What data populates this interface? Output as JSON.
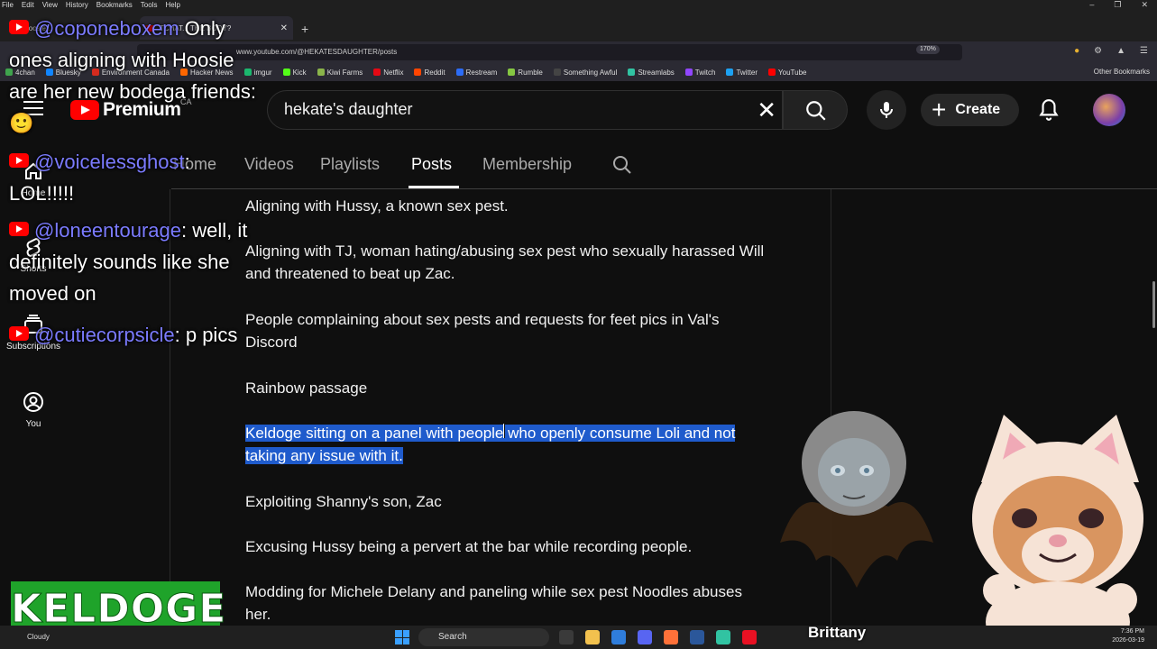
{
  "browser": {
    "menu": [
      "File",
      "Edit",
      "View",
      "History",
      "Bookmarks",
      "Tools",
      "Help"
    ],
    "tabs": [
      {
        "label": "Hoosie...",
        "active": false
      },
      {
        "label": "TCHAT... THE BODY?",
        "active": true
      }
    ],
    "url": "www.youtube.com/@HEKATESDAUGHTER/posts",
    "zoom": "170%",
    "bookmarks": [
      {
        "label": "4chan",
        "color": "#3fa34d"
      },
      {
        "label": "Bluesky",
        "color": "#1185fe"
      },
      {
        "label": "Environment Canada",
        "color": "#d52b1e"
      },
      {
        "label": "Hacker News",
        "color": "#ff6600"
      },
      {
        "label": "imgur",
        "color": "#1bb76e"
      },
      {
        "label": "Kick",
        "color": "#53fc18"
      },
      {
        "label": "Kiwi Farms",
        "color": "#8ab44a"
      },
      {
        "label": "Netflix",
        "color": "#e50914"
      },
      {
        "label": "Reddit",
        "color": "#ff4500"
      },
      {
        "label": "Restream",
        "color": "#2c6cf6"
      },
      {
        "label": "Rumble",
        "color": "#85c742"
      },
      {
        "label": "Something Awful",
        "color": "#444444"
      },
      {
        "label": "Streamlabs",
        "color": "#31c3a2"
      },
      {
        "label": "Twitch",
        "color": "#9146ff"
      },
      {
        "label": "Twitter",
        "color": "#1da1f2"
      },
      {
        "label": "YouTube",
        "color": "#ff0000"
      }
    ],
    "other_bookmarks": "Other Bookmarks"
  },
  "youtube": {
    "logo_text": "Premium",
    "region": "CA",
    "search_value": "hekate's daughter",
    "create_label": "Create",
    "channel_tabs": [
      {
        "label": "Home",
        "active": false
      },
      {
        "label": "Videos",
        "active": false
      },
      {
        "label": "Playlists",
        "active": false
      },
      {
        "label": "Posts",
        "active": true
      },
      {
        "label": "Membership",
        "active": false
      }
    ],
    "guide": [
      {
        "label": "Home",
        "icon": "home-icon"
      },
      {
        "label": "Shorts",
        "icon": "shorts-icon"
      },
      {
        "label": "Subscriptions",
        "icon": "subscriptions-icon"
      },
      {
        "label": "You",
        "icon": "you-icon"
      }
    ]
  },
  "post": {
    "items": [
      "Aligning with Hussy, a known sex pest.",
      "Aligning with TJ, woman hating/abusing sex pest who sexually harassed Will and threatened to beat up Zac.",
      "People complaining about sex pests and requests for feet pics in Val's Discord",
      "Rainbow passage",
      "Keldoge sitting on a panel with people who openly consume Loli and not taking any issue with it.",
      "Exploiting Shanny's son, Zac",
      "Excusing Hussy being a pervert at the bar while recording people.",
      "Modding for Michele Delany and paneling while sex pest Noodles abuses her."
    ],
    "highlighted_index": 4
  },
  "chat": [
    {
      "user": "@coponeboxem",
      "text": "Only ones aligning with Hoosie are her new bodega friends: 🙂"
    },
    {
      "user": "@voicelessghost",
      "text": ": LOL!!!!!"
    },
    {
      "user": "@loneentourage",
      "text": ": well, it definitely sounds like she moved on"
    },
    {
      "user": "@cutiecorpsicle",
      "text": ": p pics"
    }
  ],
  "overlay": {
    "logo": "KELDOGE",
    "name_tag": "Brittany"
  },
  "taskbar": {
    "weather": "Cloudy",
    "search": "Search",
    "time": "7:36 PM",
    "date": "2026-03-19",
    "icon_colors": [
      "#3a3a3a",
      "#f2c14e",
      "#2f7ddb",
      "#5865f2",
      "#ff7139",
      "#2b579a",
      "#31c3a2",
      "#e81123"
    ]
  }
}
